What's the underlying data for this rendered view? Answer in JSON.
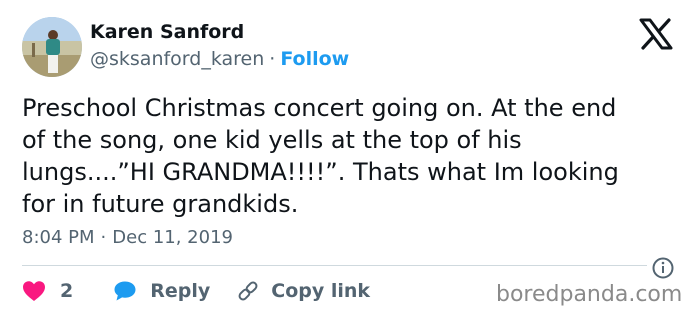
{
  "author": {
    "name": "Karen Sanford",
    "handle": "@sksanford_karen",
    "separator": "·",
    "follow_label": "Follow"
  },
  "platform_logo": "x-logo",
  "tweet": {
    "text": "Preschool Christmas concert going on. At the end\nof the song, one kid yells at the top of his\nlungs....”HI GRANDMA!!!!”. Thats what Im looking\nfor in future grandkids.",
    "time": "8:04 PM",
    "separator": "·",
    "date": "Dec 11, 2019"
  },
  "actions": {
    "like_count": "2",
    "reply_label": "Reply",
    "copy_link_label": "Copy link"
  },
  "icons": {
    "like": "heart-icon",
    "reply": "speech-bubble-icon",
    "copy_link": "link-icon",
    "info": "info-icon"
  },
  "colors": {
    "text": "#0f1419",
    "secondary": "#536471",
    "follow": "#1d9bf0",
    "like": "#f91880",
    "reply": "#1d9bf0",
    "divider": "#cfd9de"
  },
  "watermark": "boredpanda.com"
}
